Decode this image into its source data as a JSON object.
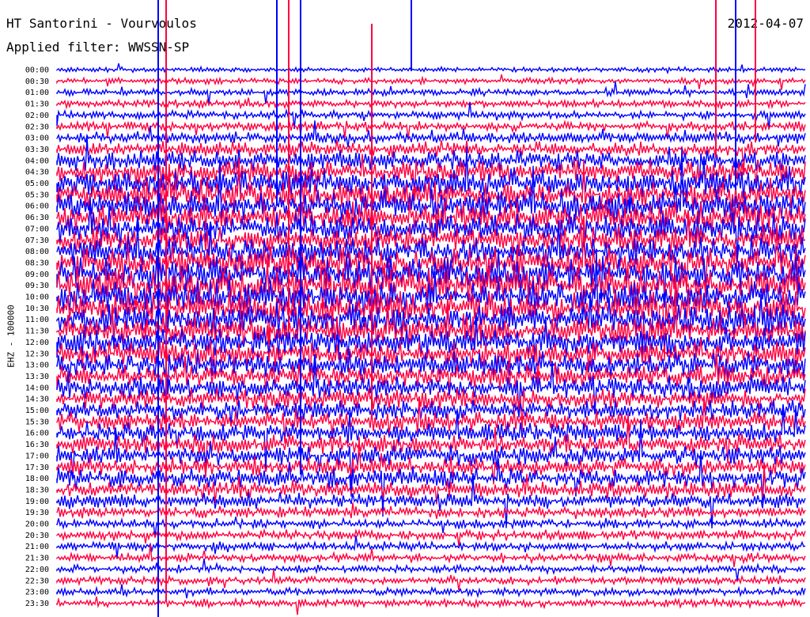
{
  "header": {
    "title": "HT Santorini - Vourvoulos",
    "filter": "Applied filter: WWSSN-SP",
    "date": "2012-04-07"
  },
  "chart_data": {
    "type": "line",
    "title": "HT Santorini - Vourvoulos",
    "subtitle": "Applied filter: WWSSN-SP",
    "date": "2012-04-07",
    "ylabel": "EHZ - 100000",
    "xlabel": "",
    "grid": false,
    "series_colors": [
      "#0000ff",
      "#ff0040"
    ],
    "row_labels": [
      "00:00",
      "00:30",
      "01:00",
      "01:30",
      "02:00",
      "02:30",
      "03:00",
      "03:30",
      "04:00",
      "04:30",
      "05:00",
      "05:30",
      "06:00",
      "06:30",
      "07:00",
      "07:30",
      "08:00",
      "08:30",
      "09:00",
      "09:30",
      "10:00",
      "10:30",
      "11:00",
      "11:30",
      "12:00",
      "12:30",
      "13:00",
      "13:30",
      "14:00",
      "14:30",
      "15:00",
      "15:30",
      "16:00",
      "16:30",
      "17:00",
      "17:30",
      "18:00",
      "18:30",
      "19:00",
      "19:30",
      "20:00",
      "20:30",
      "21:00",
      "21:30",
      "22:00",
      "22:30",
      "23:00",
      "23:30"
    ],
    "activity_level": [
      0.25,
      0.3,
      0.35,
      0.4,
      0.45,
      0.5,
      0.6,
      0.8,
      1.0,
      1.2,
      1.4,
      1.5,
      1.6,
      1.6,
      1.5,
      1.4,
      1.5,
      1.6,
      1.7,
      1.8,
      1.7,
      1.6,
      1.6,
      1.5,
      1.5,
      1.4,
      1.3,
      1.2,
      1.2,
      1.1,
      1.0,
      1.0,
      1.0,
      1.0,
      1.0,
      1.0,
      1.0,
      0.9,
      0.8,
      0.6,
      0.5,
      0.5,
      0.45,
      0.45,
      0.4,
      0.4,
      0.4,
      0.4
    ]
  }
}
